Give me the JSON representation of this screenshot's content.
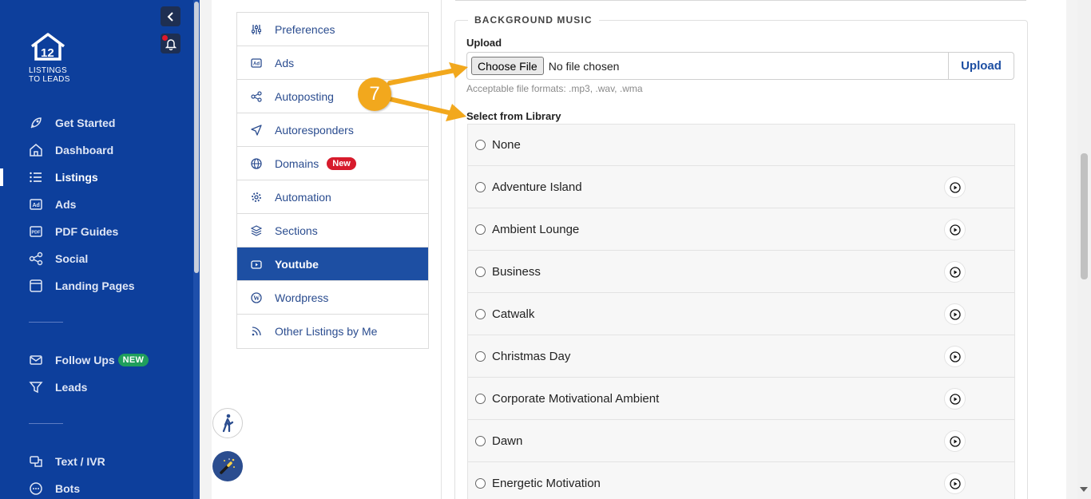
{
  "sidebar": {
    "logo_line1": "LISTINGS",
    "logo_line2": "TO LEADS",
    "nav_main": [
      {
        "label": "Get Started",
        "icon": "rocket-icon"
      },
      {
        "label": "Dashboard",
        "icon": "home-icon"
      },
      {
        "label": "Listings",
        "icon": "list-icon",
        "active": true
      },
      {
        "label": "Ads",
        "icon": "ad-icon"
      },
      {
        "label": "PDF Guides",
        "icon": "pdf-icon"
      },
      {
        "label": "Social",
        "icon": "share-icon"
      },
      {
        "label": "Landing Pages",
        "icon": "page-icon"
      }
    ],
    "nav_leads": [
      {
        "label": "Follow Ups",
        "icon": "mail-icon",
        "badge": "NEW"
      },
      {
        "label": "Leads",
        "icon": "filter-icon"
      }
    ],
    "nav_comm": [
      {
        "label": "Text / IVR",
        "icon": "chat-icon"
      },
      {
        "label": "Bots",
        "icon": "bot-icon"
      }
    ]
  },
  "settings_menu": [
    {
      "label": "Preferences",
      "icon": "sliders-icon"
    },
    {
      "label": "Ads",
      "icon": "ad-icon"
    },
    {
      "label": "Autoposting",
      "icon": "share-icon"
    },
    {
      "label": "Autoresponders",
      "icon": "send-icon"
    },
    {
      "label": "Domains",
      "icon": "globe-icon",
      "badge": "New"
    },
    {
      "label": "Automation",
      "icon": "gear-icon"
    },
    {
      "label": "Sections",
      "icon": "layers-icon"
    },
    {
      "label": "Youtube",
      "icon": "youtube-icon",
      "active": true
    },
    {
      "label": "Wordpress",
      "icon": "wordpress-icon"
    },
    {
      "label": "Other Listings by Me",
      "icon": "rss-icon"
    }
  ],
  "background_music": {
    "legend": "BACKGROUND MUSIC",
    "upload_label": "Upload",
    "choose_file": "Choose File",
    "no_file": "No file chosen",
    "upload_button": "Upload",
    "hint": "Acceptable file formats: .mp3, .wav, .wma",
    "library_label": "Select from Library",
    "tracks": [
      {
        "name": "None",
        "playable": false
      },
      {
        "name": "Adventure Island",
        "playable": true
      },
      {
        "name": "Ambient Lounge",
        "playable": true
      },
      {
        "name": "Business",
        "playable": true
      },
      {
        "name": "Catwalk",
        "playable": true
      },
      {
        "name": "Christmas Day",
        "playable": true
      },
      {
        "name": "Corporate Motivational Ambient",
        "playable": true
      },
      {
        "name": "Dawn",
        "playable": true
      },
      {
        "name": "Energetic Motivation",
        "playable": true
      }
    ]
  },
  "callout": {
    "number": "7",
    "color": "#f2a81d"
  },
  "colors": {
    "sidebar": "#0d3f9c",
    "accent": "#1d4fa3",
    "badge_red": "#d71b2c",
    "badge_green": "#1f9e5c"
  }
}
